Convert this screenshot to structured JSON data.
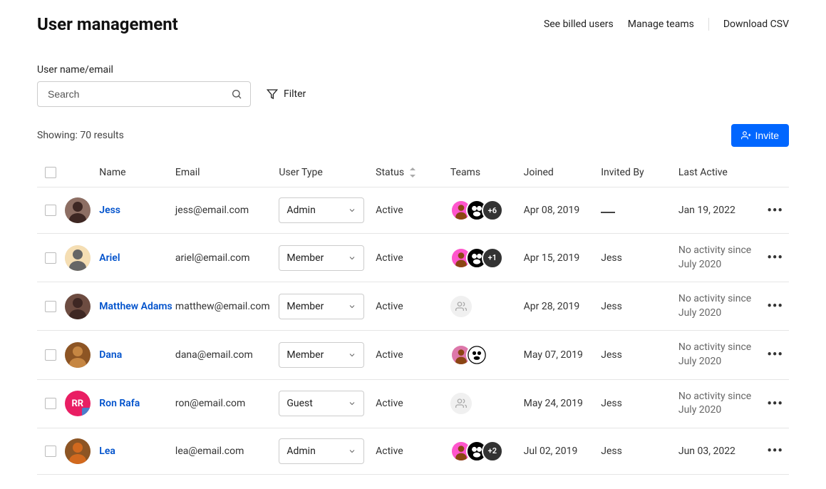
{
  "header": {
    "title": "User management",
    "links": {
      "billed": "See billed users",
      "teams": "Manage teams",
      "csv": "Download CSV"
    }
  },
  "search": {
    "label": "User name/email",
    "placeholder": "Search",
    "filter_label": "Filter"
  },
  "results": {
    "text": "Showing: 70 results",
    "invite_label": "Invite"
  },
  "columns": {
    "name": "Name",
    "email": "Email",
    "usertype": "User Type",
    "status": "Status",
    "teams": "Teams",
    "joined": "Joined",
    "invited": "Invited By",
    "active": "Last Active"
  },
  "rows": [
    {
      "name": "Jess",
      "email": "jess@email.com",
      "usertype": "Admin",
      "status": "Active",
      "teams_type": "multi",
      "teams_more": "+6",
      "joined": "Apr 08, 2019",
      "invited": "",
      "active": "Jan 19, 2022",
      "active_gray": false,
      "avatar_type": "photo",
      "avatar_colors": [
        "#8d6e63",
        "#3e2723"
      ]
    },
    {
      "name": "Ariel",
      "email": "ariel@email.com",
      "usertype": "Member",
      "status": "Active",
      "teams_type": "multi",
      "teams_more": "+1",
      "joined": "Apr 15, 2019",
      "invited": "Jess",
      "active": "No activity since July 2020",
      "active_gray": true,
      "avatar_type": "photo",
      "avatar_colors": [
        "#f5deb3",
        "#666"
      ]
    },
    {
      "name": "Matthew Adams",
      "email": "matthew@email.com",
      "usertype": "Member",
      "status": "Active",
      "teams_type": "placeholder",
      "teams_more": "",
      "joined": "Apr 28, 2019",
      "invited": "Jess",
      "active": "No activity since July 2020",
      "active_gray": true,
      "avatar_type": "photo",
      "avatar_colors": [
        "#6d4c41",
        "#3e2723"
      ]
    },
    {
      "name": "Dana",
      "email": "dana@email.com",
      "usertype": "Member",
      "status": "Active",
      "teams_type": "two",
      "teams_more": "",
      "joined": "May 07, 2019",
      "invited": "Jess",
      "active": "No activity since July 2020",
      "active_gray": true,
      "avatar_type": "photo",
      "avatar_colors": [
        "#8d5524",
        "#c68642"
      ]
    },
    {
      "name": "Ron Rafa",
      "email": "ron@email.com",
      "usertype": "Guest",
      "status": "Active",
      "teams_type": "placeholder",
      "teams_more": "",
      "joined": "May 24, 2019",
      "invited": "Jess",
      "active": "No activity since July 2020",
      "active_gray": true,
      "avatar_type": "initials",
      "avatar_initials": "RR",
      "avatar_badge": true
    },
    {
      "name": "Lea",
      "email": "lea@email.com",
      "usertype": "Admin",
      "status": "Active",
      "teams_type": "multi",
      "teams_more": "+2",
      "joined": "Jul 02, 2019",
      "invited": "Jess",
      "active": "Jun 03, 2022",
      "active_gray": false,
      "avatar_type": "photo",
      "avatar_colors": [
        "#8d5524",
        "#d2691e"
      ]
    }
  ]
}
